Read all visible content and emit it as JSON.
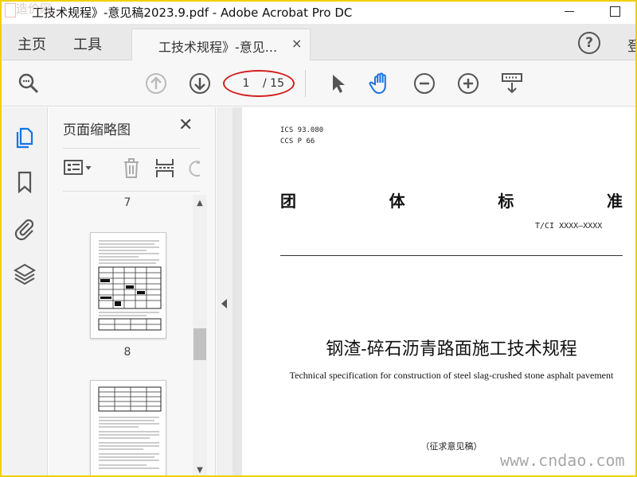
{
  "window": {
    "title": "工技术规程》-意见稿2023.9.pdf - Adobe Acrobat Pro DC",
    "watermark_logo": "造价网"
  },
  "tabs": {
    "home": "主页",
    "tools": "工具",
    "document": "工技术规程》-意见...",
    "close": "×",
    "signin": "登"
  },
  "toolbar": {
    "current_page": "1",
    "total_pages": "/ 15",
    "highlight_color": "#d41e1e",
    "accent_color": "#1473e6"
  },
  "thumbnail_panel": {
    "title": "页面缩略图",
    "close": "✕",
    "labels": [
      "7",
      "8"
    ]
  },
  "document": {
    "ics": "ICS  93.080",
    "ccs": "CCS  P  66",
    "group_chars": [
      "团",
      "体",
      "标",
      "准"
    ],
    "standard_number": "T/CI  XXXX—XXXX",
    "title_cn": "钢渣-碎石沥青路面施工技术规程",
    "title_en": "Technical specification for construction of steel slag-crushed stone asphalt pavement",
    "draft_note": "（征求意见稿）"
  },
  "site_watermark": "www.cndao.com"
}
